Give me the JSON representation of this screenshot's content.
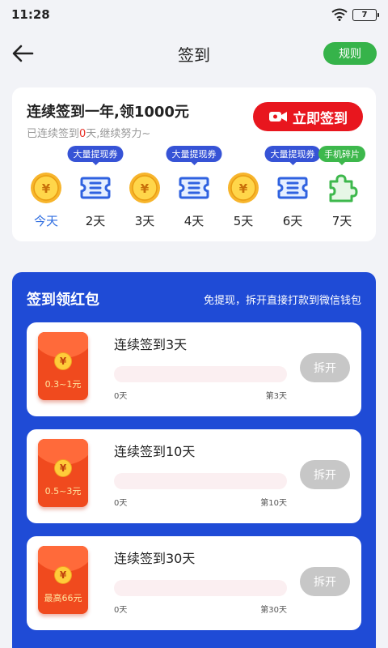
{
  "status": {
    "time": "11:28",
    "battery": "7"
  },
  "header": {
    "title": "签到",
    "rules_label": "规则"
  },
  "checkin": {
    "title": "连续签到一年,领1000元",
    "sub_prefix": "已连续签到",
    "sub_days": "0",
    "sub_suffix": "天,继续努力~",
    "button_label": "立即签到",
    "days": [
      {
        "label": "今天",
        "icon": "yuan-coin-icon",
        "badge": ""
      },
      {
        "label": "2天",
        "icon": "ticket-icon",
        "badge": "大量提现券"
      },
      {
        "label": "3天",
        "icon": "yuan-coin-icon",
        "badge": ""
      },
      {
        "label": "4天",
        "icon": "ticket-icon",
        "badge": "大量提现券"
      },
      {
        "label": "5天",
        "icon": "yuan-coin-icon",
        "badge": ""
      },
      {
        "label": "6天",
        "icon": "ticket-icon",
        "badge": "大量提现券"
      },
      {
        "label": "7天",
        "icon": "puzzle-icon",
        "badge": "手机碎片"
      }
    ]
  },
  "redpacket": {
    "title": "签到领红包",
    "subtitle": "免提现，拆开直接打款到微信钱包",
    "items": [
      {
        "amount": "0.3~1元",
        "name": "连续签到3天",
        "start": "0天",
        "end": "第3天",
        "progress": 0,
        "button": "拆开"
      },
      {
        "amount": "0.5~3元",
        "name": "连续签到10天",
        "start": "0天",
        "end": "第10天",
        "progress": 0,
        "button": "拆开"
      },
      {
        "amount": "最高66元",
        "name": "连续签到30天",
        "start": "0天",
        "end": "第30天",
        "progress": 0,
        "button": "拆开"
      }
    ]
  },
  "colors": {
    "accent_blue": "#1f4bd6",
    "checkin_red": "#e8161e",
    "rules_green": "#36b34a",
    "today_blue": "#2f6de0"
  }
}
